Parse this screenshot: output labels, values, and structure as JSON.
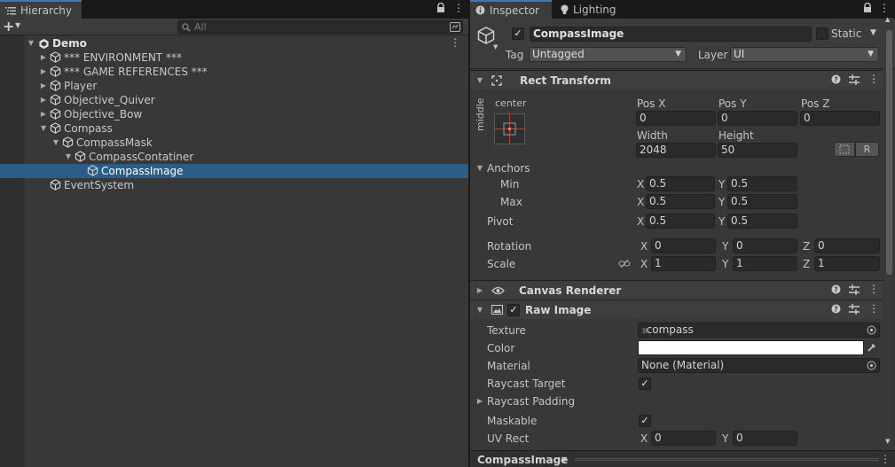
{
  "hierarchy": {
    "tab_label": "Hierarchy",
    "search_placeholder": "All",
    "add_button": "+",
    "scene_name": "Demo",
    "items": [
      {
        "label": "*** ENVIRONMENT ***",
        "depth": 1,
        "foldout": "closed"
      },
      {
        "label": "*** GAME REFERENCES ***",
        "depth": 1,
        "foldout": "closed"
      },
      {
        "label": "Player",
        "depth": 1,
        "foldout": "closed"
      },
      {
        "label": "Objective_Quiver",
        "depth": 1,
        "foldout": "closed"
      },
      {
        "label": "Objective_Bow",
        "depth": 1,
        "foldout": "closed"
      },
      {
        "label": "Compass",
        "depth": 1,
        "foldout": "open"
      },
      {
        "label": "CompassMask",
        "depth": 2,
        "foldout": "open"
      },
      {
        "label": "CompassContatiner",
        "depth": 3,
        "foldout": "open"
      },
      {
        "label": "CompassImage",
        "depth": 4,
        "foldout": "none",
        "selected": true
      },
      {
        "label": "EventSystem",
        "depth": 1,
        "foldout": "none"
      }
    ]
  },
  "inspector": {
    "tabs": [
      {
        "label": "Inspector",
        "icon": "info-icon",
        "active": true
      },
      {
        "label": "Lighting",
        "icon": "bulb-icon",
        "active": false
      }
    ],
    "object_name": "CompassImage",
    "static_label": "Static",
    "tag_label": "Tag",
    "tag_value": "Untagged",
    "layer_label": "Layer",
    "layer_value": "UI",
    "rect_transform": {
      "title": "Rect Transform",
      "anchor_h": "center",
      "anchor_v": "middle",
      "pos_x_label": "Pos X",
      "pos_x": "0",
      "pos_y_label": "Pos Y",
      "pos_y": "0",
      "pos_z_label": "Pos Z",
      "pos_z": "0",
      "width_label": "Width",
      "width": "2048",
      "height_label": "Height",
      "height": "50",
      "r_button": "R",
      "anchors_label": "Anchors",
      "min_label": "Min",
      "min_x": "0.5",
      "min_y": "0.5",
      "max_label": "Max",
      "max_x": "0.5",
      "max_y": "0.5",
      "pivot_label": "Pivot",
      "pivot_x": "0.5",
      "pivot_y": "0.5",
      "rotation_label": "Rotation",
      "rot_x": "0",
      "rot_y": "0",
      "rot_z": "0",
      "scale_label": "Scale",
      "scale_x": "1",
      "scale_y": "1",
      "scale_z": "1",
      "x": "X",
      "y": "Y",
      "z": "Z"
    },
    "canvas_renderer": {
      "title": "Canvas Renderer"
    },
    "raw_image": {
      "title": "Raw Image",
      "texture_label": "Texture",
      "texture_value": "compass",
      "color_label": "Color",
      "color_value": "#ffffff",
      "material_label": "Material",
      "material_value": "None (Material)",
      "raycast_target_label": "Raycast Target",
      "raycast_padding_label": "Raycast Padding",
      "maskable_label": "Maskable",
      "uv_rect_label": "UV Rect",
      "uv_x": "0",
      "uv_y": "0"
    },
    "footer_label": "CompassImage"
  },
  "colors": {
    "selection": "#2c5d87",
    "accent": "#3a79bb",
    "panel": "#383838"
  }
}
